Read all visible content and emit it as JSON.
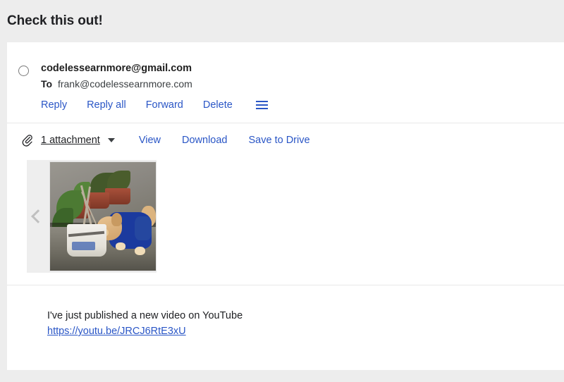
{
  "header": {
    "subject": "Check this out!"
  },
  "message": {
    "avatar_icon": "empty-circle-avatar",
    "sender": "codelessearnmore@gmail.com",
    "to_label": "To",
    "to_address": "frank@codelessearnmore.com",
    "actions": [
      {
        "label": "Reply",
        "name": "reply"
      },
      {
        "label": "Reply all",
        "name": "reply-all"
      },
      {
        "label": "Forward",
        "name": "forward"
      },
      {
        "label": "Delete",
        "name": "delete"
      }
    ],
    "more_menu_icon": "hamburger-menu-icon"
  },
  "attachments": {
    "clip_icon": "paperclip-icon",
    "count_label": "1 attachment",
    "caret_icon": "caret-down-icon",
    "links": [
      {
        "label": "View",
        "name": "view"
      },
      {
        "label": "Download",
        "name": "download"
      },
      {
        "label": "Save to Drive",
        "name": "save-to-drive"
      }
    ],
    "carousel": {
      "prev_icon": "chevron-left-icon",
      "thumbnail_alt": "puppy-in-blue-shirt-photo"
    }
  },
  "body": {
    "line1": "I've just published a new video on YouTube",
    "link": "https://youtu.be/JRCJ6RtE3xU"
  },
  "colors": {
    "page_background": "#ededed",
    "card_background": "#ffffff",
    "link_blue": "#2a56c6",
    "text_primary": "#202124",
    "divider": "#e8e8e8",
    "carousel_background": "#eeeeee"
  }
}
